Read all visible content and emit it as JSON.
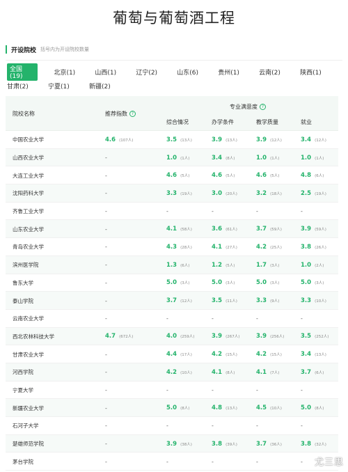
{
  "page_title": "葡萄与葡萄酒工程",
  "section": {
    "title": "开设院校",
    "note": "括号内为开设院校数量"
  },
  "provinces": [
    [
      "全国(19)",
      "北京(1)",
      "山西(1)",
      "辽宁(2)",
      "山东(6)",
      "贵州(1)",
      "云南(2)",
      "陕西(1)"
    ],
    [
      "甘肃(2)",
      "宁夏(1)",
      "新疆(2)"
    ]
  ],
  "table": {
    "header": {
      "school": "院校名称",
      "recommend": "推荐指数",
      "satisfaction": "专业满意度",
      "overall": "综合情况",
      "facility": "办学条件",
      "teaching": "教学质量",
      "employment": "就业"
    },
    "rows": [
      {
        "name": "中国农业大学",
        "cells": [
          [
            "4.6",
            "(107人)"
          ],
          [
            "3.5",
            "(13人)"
          ],
          [
            "3.9",
            "(13人)"
          ],
          [
            "3.9",
            "(12人)"
          ],
          [
            "3.4",
            "(12人)"
          ]
        ]
      },
      {
        "name": "山西农业大学",
        "cells": [
          [
            "-",
            ""
          ],
          [
            "1.0",
            "(1人)"
          ],
          [
            "3.4",
            "(8人)"
          ],
          [
            "1.0",
            "(1人)"
          ],
          [
            "1.0",
            "(1人)"
          ]
        ]
      },
      {
        "name": "大连工业大学",
        "cells": [
          [
            "-",
            ""
          ],
          [
            "4.6",
            "(5人)"
          ],
          [
            "4.6",
            "(5人)"
          ],
          [
            "4.6",
            "(5人)"
          ],
          [
            "4.8",
            "(6人)"
          ]
        ]
      },
      {
        "name": "沈阳药科大学",
        "cells": [
          [
            "-",
            ""
          ],
          [
            "3.3",
            "(19人)"
          ],
          [
            "3.0",
            "(20人)"
          ],
          [
            "3.2",
            "(18人)"
          ],
          [
            "2.5",
            "(19人)"
          ]
        ]
      },
      {
        "name": "齐鲁工业大学",
        "cells": [
          [
            "-",
            ""
          ],
          [
            "-",
            ""
          ],
          [
            "-",
            ""
          ],
          [
            "-",
            ""
          ],
          [
            "-",
            ""
          ]
        ]
      },
      {
        "name": "山东农业大学",
        "cells": [
          [
            "-",
            ""
          ],
          [
            "4.1",
            "(58人)"
          ],
          [
            "3.6",
            "(61人)"
          ],
          [
            "3.7",
            "(59人)"
          ],
          [
            "3.9",
            "(59人)"
          ]
        ]
      },
      {
        "name": "青岛农业大学",
        "cells": [
          [
            "-",
            ""
          ],
          [
            "4.3",
            "(28人)"
          ],
          [
            "4.1",
            "(27人)"
          ],
          [
            "4.2",
            "(25人)"
          ],
          [
            "3.8",
            "(26人)"
          ]
        ]
      },
      {
        "name": "滨州医学院",
        "cells": [
          [
            "-",
            ""
          ],
          [
            "1.3",
            "(6人)"
          ],
          [
            "1.2",
            "(5人)"
          ],
          [
            "1.7",
            "(3人)"
          ],
          [
            "1.0",
            "(2人)"
          ]
        ]
      },
      {
        "name": "鲁东大学",
        "cells": [
          [
            "-",
            ""
          ],
          [
            "5.0",
            "(3人)"
          ],
          [
            "5.0",
            "(3人)"
          ],
          [
            "5.0",
            "(3人)"
          ],
          [
            "5.0",
            "(3人)"
          ]
        ]
      },
      {
        "name": "泰山学院",
        "cells": [
          [
            "-",
            ""
          ],
          [
            "3.7",
            "(12人)"
          ],
          [
            "3.5",
            "(11人)"
          ],
          [
            "3.3",
            "(9人)"
          ],
          [
            "3.3",
            "(10人)"
          ]
        ]
      },
      {
        "name": "云南农业大学",
        "cells": [
          [
            "-",
            ""
          ],
          [
            "-",
            ""
          ],
          [
            "-",
            ""
          ],
          [
            "-",
            ""
          ],
          [
            "-",
            ""
          ]
        ]
      },
      {
        "name": "西北农林科技大学",
        "cells": [
          [
            "4.7",
            "(672人)"
          ],
          [
            "4.0",
            "(259人)"
          ],
          [
            "3.9",
            "(267人)"
          ],
          [
            "3.9",
            "(256人)"
          ],
          [
            "3.5",
            "(252人)"
          ]
        ]
      },
      {
        "name": "甘肃农业大学",
        "cells": [
          [
            "-",
            ""
          ],
          [
            "4.4",
            "(17人)"
          ],
          [
            "4.2",
            "(15人)"
          ],
          [
            "4.2",
            "(15人)"
          ],
          [
            "3.4",
            "(13人)"
          ]
        ]
      },
      {
        "name": "河西学院",
        "cells": [
          [
            "-",
            ""
          ],
          [
            "4.2",
            "(10人)"
          ],
          [
            "4.1",
            "(8人)"
          ],
          [
            "4.1",
            "(7人)"
          ],
          [
            "3.7",
            "(6人)"
          ]
        ]
      },
      {
        "name": "宁夏大学",
        "cells": [
          [
            "-",
            ""
          ],
          [
            "-",
            ""
          ],
          [
            "-",
            ""
          ],
          [
            "-",
            ""
          ],
          [
            "-",
            ""
          ]
        ]
      },
      {
        "name": "新疆农业大学",
        "cells": [
          [
            "-",
            ""
          ],
          [
            "5.0",
            "(8人)"
          ],
          [
            "4.8",
            "(13人)"
          ],
          [
            "4.5",
            "(10人)"
          ],
          [
            "5.0",
            "(8人)"
          ]
        ]
      },
      {
        "name": "石河子大学",
        "cells": [
          [
            "-",
            ""
          ],
          [
            "-",
            ""
          ],
          [
            "-",
            ""
          ],
          [
            "-",
            ""
          ],
          [
            "-",
            ""
          ]
        ]
      },
      {
        "name": "楚雄师范学院",
        "cells": [
          [
            "-",
            ""
          ],
          [
            "3.9",
            "(38人)"
          ],
          [
            "3.8",
            "(39人)"
          ],
          [
            "3.7",
            "(36人)"
          ],
          [
            "3.8",
            "(32人)"
          ]
        ]
      },
      {
        "name": "茅台学院",
        "cells": [
          [
            "-",
            ""
          ],
          [
            "-",
            ""
          ],
          [
            "-",
            ""
          ],
          [
            "-",
            ""
          ],
          [
            "-",
            ""
          ]
        ]
      }
    ]
  },
  "watermark": "尤三思",
  "colors": {
    "accent": "#24b36b",
    "header_bg": "#f3f8f5"
  },
  "icons": {
    "help": "question-circle-icon"
  }
}
